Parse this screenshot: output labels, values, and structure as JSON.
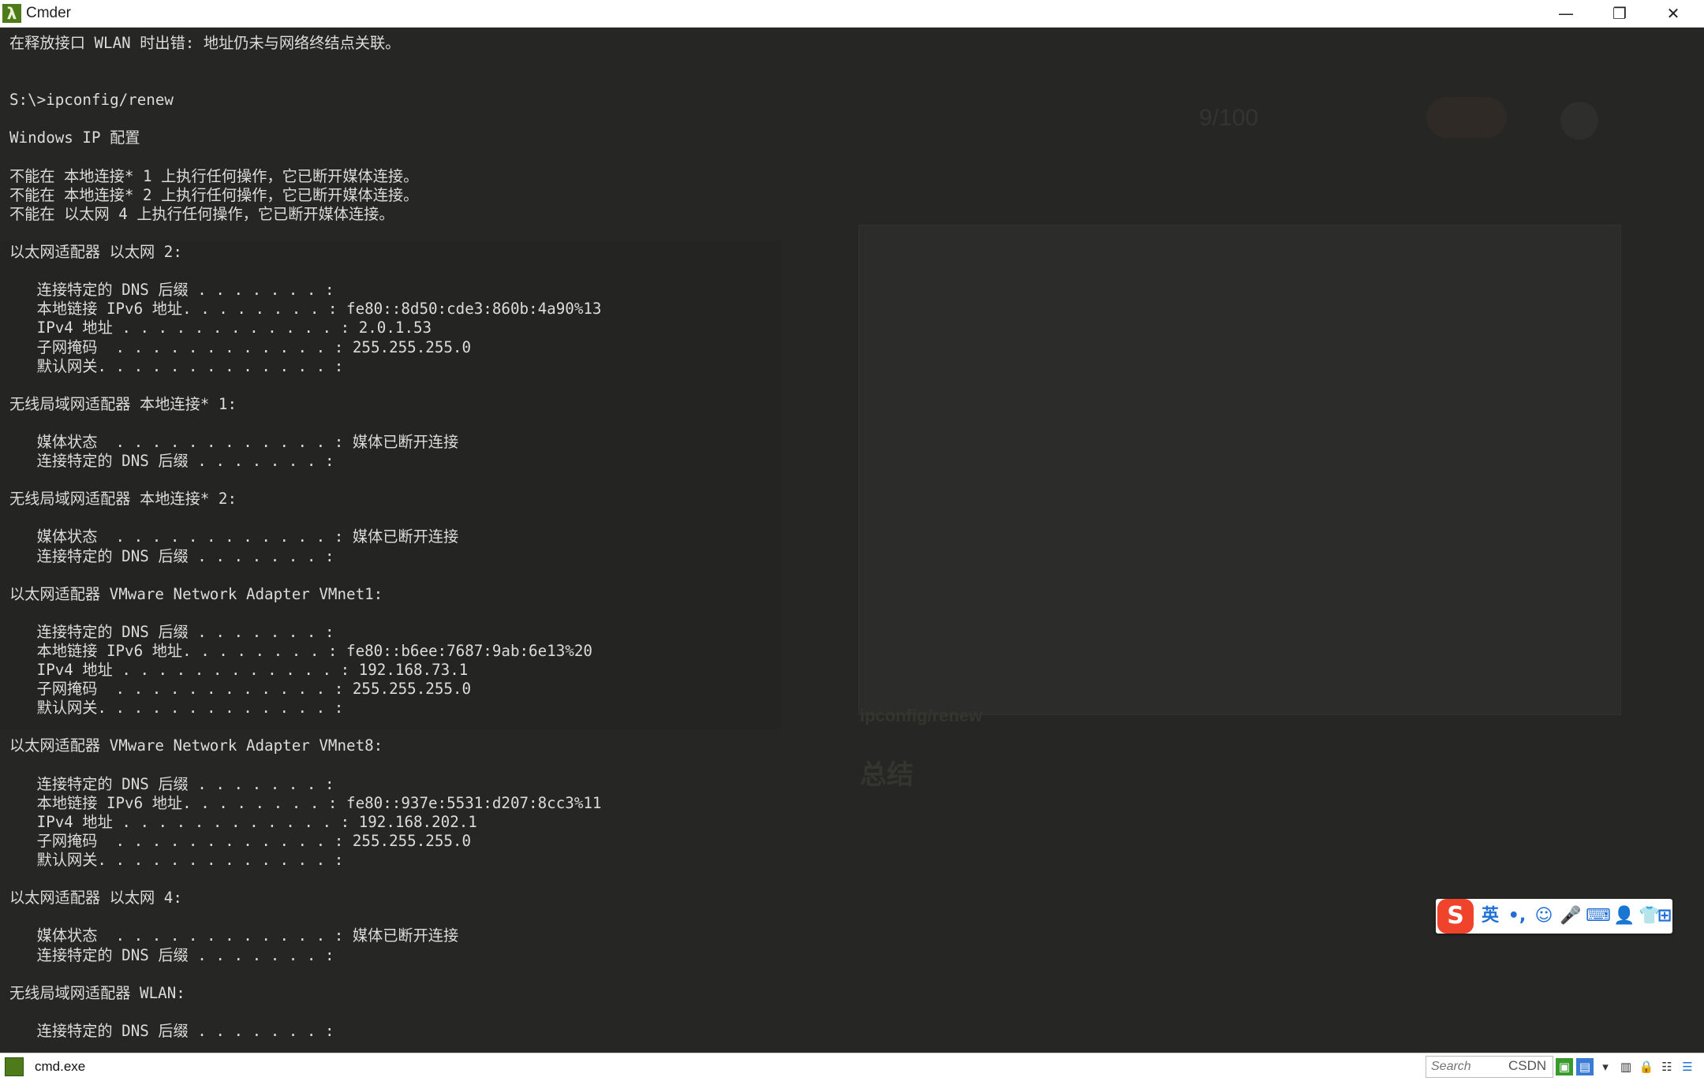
{
  "window": {
    "title": "Cmder",
    "app_icon_glyph": "λ",
    "controls": {
      "minimize": "—",
      "restore": "❐",
      "close": "✕"
    }
  },
  "terminal": {
    "lines": [
      "在释放接口 WLAN 时出错: 地址仍未与网络终结点关联。",
      "",
      "",
      "S:\\>ipconfig/renew",
      "",
      "Windows IP 配置",
      "",
      "不能在 本地连接* 1 上执行任何操作，它已断开媒体连接。",
      "不能在 本地连接* 2 上执行任何操作，它已断开媒体连接。",
      "不能在 以太网 4 上执行任何操作，它已断开媒体连接。",
      "",
      "以太网适配器 以太网 2:",
      "",
      "   连接特定的 DNS 后缀 . . . . . . . :",
      "   本地链接 IPv6 地址. . . . . . . . : fe80::8d50:cde3:860b:4a90%13",
      "   IPv4 地址 . . . . . . . . . . . . : 2.0.1.53",
      "   子网掩码  . . . . . . . . . . . . : 255.255.255.0",
      "   默认网关. . . . . . . . . . . . . :",
      "",
      "无线局域网适配器 本地连接* 1:",
      "",
      "   媒体状态  . . . . . . . . . . . . : 媒体已断开连接",
      "   连接特定的 DNS 后缀 . . . . . . . :",
      "",
      "无线局域网适配器 本地连接* 2:",
      "",
      "   媒体状态  . . . . . . . . . . . . : 媒体已断开连接",
      "   连接特定的 DNS 后缀 . . . . . . . :",
      "",
      "以太网适配器 VMware Network Adapter VMnet1:",
      "",
      "   连接特定的 DNS 后缀 . . . . . . . :",
      "   本地链接 IPv6 地址. . . . . . . . : fe80::b6ee:7687:9ab:6e13%20",
      "   IPv4 地址 . . . . . . . . . . . . : 192.168.73.1",
      "   子网掩码  . . . . . . . . . . . . : 255.255.255.0",
      "   默认网关. . . . . . . . . . . . . :",
      "",
      "以太网适配器 VMware Network Adapter VMnet8:",
      "",
      "   连接特定的 DNS 后缀 . . . . . . . :",
      "   本地链接 IPv6 地址. . . . . . . . : fe80::937e:5531:d207:8cc3%11",
      "   IPv4 地址 . . . . . . . . . . . . : 192.168.202.1",
      "   子网掩码  . . . . . . . . . . . . : 255.255.255.0",
      "   默认网关. . . . . . . . . . . . . :",
      "",
      "以太网适配器 以太网 4:",
      "",
      "   媒体状态  . . . . . . . . . . . . : 媒体已断开连接",
      "   连接特定的 DNS 后缀 . . . . . . . :",
      "",
      "无线局域网适配器 WLAN:",
      "",
      "   连接特定的 DNS 后缀 . . . . . . . :"
    ]
  },
  "background_ghost": {
    "counter": "9/100",
    "heading": "ipconfig/renew",
    "summary_title": "总结"
  },
  "ime_toolbar": {
    "logo": "S",
    "mode": "英",
    "punct": "•,",
    "items": [
      "☺",
      "🎤",
      "⌨",
      "👤",
      "👕",
      "⊞"
    ]
  },
  "statusbar": {
    "tab_label": "cmd.exe",
    "search_placeholder": "Search",
    "tray_text": "CSDN"
  },
  "colors": {
    "terminal_bg": "#262724",
    "terminal_fg": "#dcdcdc",
    "app_icon_green": "#4f7a19",
    "ime_logo": "#f0432c",
    "ime_blue": "#1f6fd6"
  }
}
